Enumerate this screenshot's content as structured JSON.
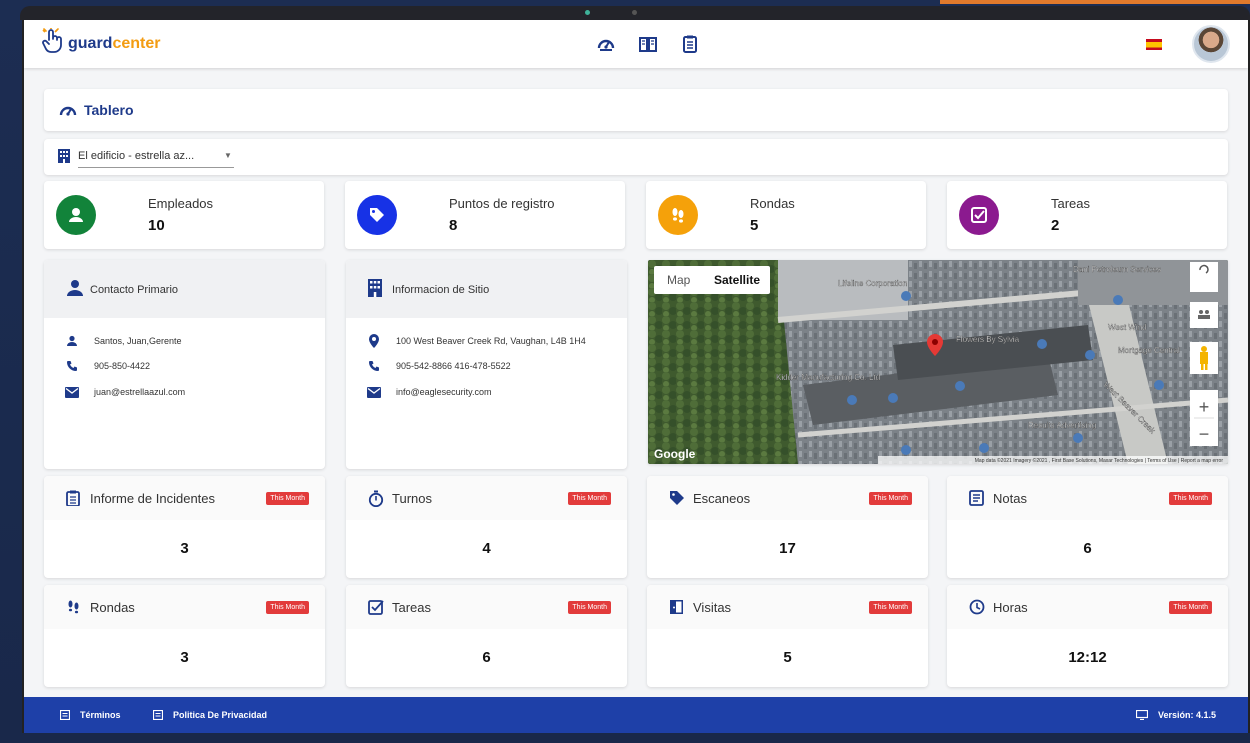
{
  "app": {
    "logo_part1": "guard",
    "logo_part2": "center"
  },
  "colors": {
    "primary": "#1e3a8a",
    "accent": "#f39c12",
    "footer": "#1e40a8",
    "badge": "#e23b3b",
    "employees": "#12833a",
    "checkpoints": "#1732e6",
    "rounds": "#f5a10a",
    "tasks": "#8b1a8f"
  },
  "header": {
    "icons": [
      "dashboard-icon",
      "book-icon",
      "clipboard-icon"
    ]
  },
  "page": {
    "title": "Tablero",
    "building_select": "El edificio - estrella az..."
  },
  "stats": [
    {
      "label": "Empleados",
      "value": "10",
      "icon": "person-icon"
    },
    {
      "label": "Puntos de registro",
      "value": "8",
      "icon": "tag-icon"
    },
    {
      "label": "Rondas",
      "value": "5",
      "icon": "footsteps-icon"
    },
    {
      "label": "Tareas",
      "value": "2",
      "icon": "checkbox-icon"
    }
  ],
  "contact": {
    "title": "Contacto Primario",
    "name": "Santos, Juan,Gerente",
    "phone": "905-850-4422",
    "email": "juan@estrellaazul.com"
  },
  "site": {
    "title": "Informacion de Sitio",
    "address": "100 West Beaver Creek Rd, Vaughan, L4B 1H4",
    "phone": "905-542-8866 416-478-5522",
    "email": "info@eaglesecurity.com"
  },
  "map": {
    "tab_map": "Map",
    "tab_satellite": "Satellite",
    "google": "Google",
    "zoom_in": "+",
    "zoom_out": "−",
    "labels": [
      "Lifeline Corporation",
      "Dani Petroleum Services",
      "West Wind",
      "Mortgage Central",
      "Flowers By Sylvia",
      "Kidder Manufacturing Co. Ltd",
      "Results Advertising",
      "West Beaver Creek"
    ],
    "attribution": "Map data ©2021 Imagery ©2021 , First Base Solutions, Maxar Technologies | Terms of Use | Report a map error"
  },
  "badge_label": "This Month",
  "metrics": [
    {
      "label": "Informe de Incidentes",
      "value": "3"
    },
    {
      "label": "Turnos",
      "value": "4"
    },
    {
      "label": "Escaneos",
      "value": "17"
    },
    {
      "label": "Notas",
      "value": "6"
    },
    {
      "label": "Rondas",
      "value": "3"
    },
    {
      "label": "Tareas",
      "value": "6"
    },
    {
      "label": "Visitas",
      "value": "5"
    },
    {
      "label": "Horas",
      "value": "12:12"
    }
  ],
  "footer": {
    "terms": "Términos",
    "privacy": "Politica De Privacidad",
    "version": "Versión: 4.1.5"
  }
}
